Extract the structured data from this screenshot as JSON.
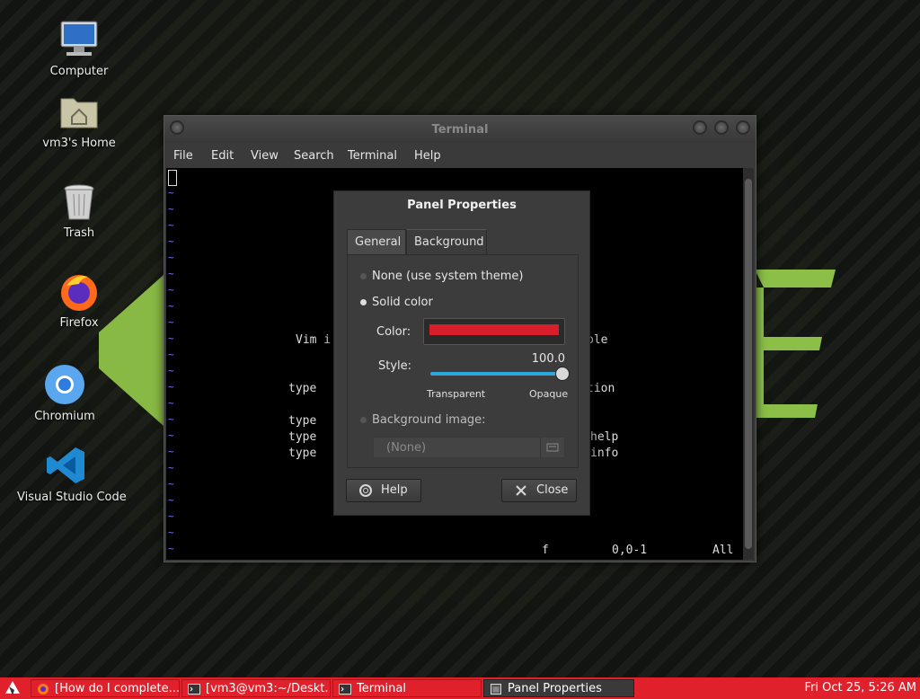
{
  "desktop": {
    "icons": [
      {
        "label": "Computer",
        "icon": "computer-icon"
      },
      {
        "label": "vm3's Home",
        "icon": "home-folder-icon"
      },
      {
        "label": "Trash",
        "icon": "trash-icon"
      },
      {
        "label": "Firefox",
        "icon": "firefox-icon"
      },
      {
        "label": "Chromium",
        "icon": "chromium-icon"
      },
      {
        "label": "Visual Studio Code",
        "icon": "vscode-icon"
      }
    ]
  },
  "terminal": {
    "title": "Terminal",
    "menu": [
      "File",
      "Edit",
      "View",
      "Search",
      "Terminal",
      "Help"
    ],
    "vim_lines": [
      {
        "text": "Vim i",
        "right": "ble"
      },
      {
        "text": "type",
        "right": "tion"
      },
      {
        "text": "type",
        "right": ""
      },
      {
        "text": "type",
        "right": "help"
      },
      {
        "text": "type",
        "right": "info"
      }
    ],
    "status": {
      "left": "f",
      "pos": "0,0-1",
      "all": "All"
    }
  },
  "dialog": {
    "title": "Panel Properties",
    "tabs": [
      "General",
      "Background"
    ],
    "active_tab": "Background",
    "options": {
      "none_label": "None (use system theme)",
      "solid_label": "Solid color",
      "image_label": "Background image:"
    },
    "color_label": "Color:",
    "color_value": "#d81e2a",
    "style_label": "Style:",
    "style_value": "100.0",
    "style_fraction": 1.0,
    "transparent_label": "Transparent",
    "opaque_label": "Opaque",
    "image_placeholder": "(None)",
    "help_button": "Help",
    "close_button": "Close"
  },
  "taskbar": {
    "tasks": [
      {
        "label": "[How do I complete...",
        "icon": "firefox-icon"
      },
      {
        "label": "[vm3@vm3:~/Deskt...",
        "icon": "terminal-icon"
      },
      {
        "label": "Terminal",
        "icon": "terminal-icon"
      },
      {
        "label": "Panel Properties",
        "icon": "window-icon",
        "active": true
      }
    ],
    "clock": "Fri Oct 25,  5:26 AM"
  },
  "colors": {
    "taskbar": "#e0202a",
    "accent": "#2aa9e0",
    "logo_green": "#8bc34a"
  }
}
